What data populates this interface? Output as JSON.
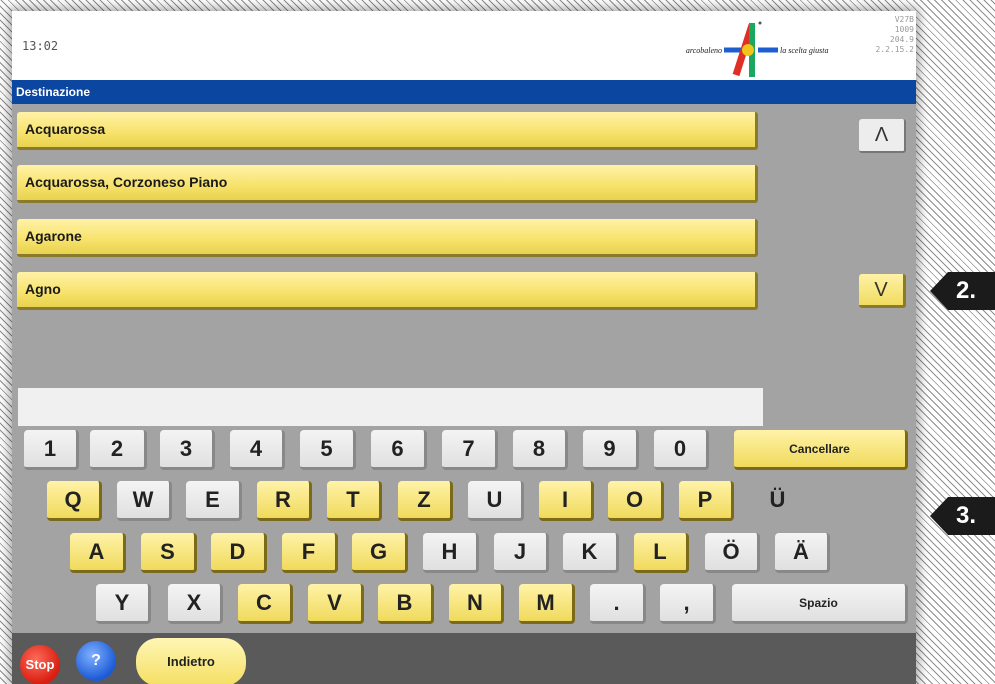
{
  "header": {
    "time": "13:02",
    "logo_left_text": "arcobaleno",
    "logo_right_text": "la scelta giusta",
    "version_lines": [
      "V27B",
      "1009",
      "204.9",
      "2.2.15.2"
    ]
  },
  "section": {
    "title": "Destinazione"
  },
  "destinations": [
    "Acquarossa",
    "Acquarossa, Corzoneso Piano",
    "Agarone",
    "Agno"
  ],
  "scroll": {
    "up_label": "Λ",
    "down_label": "V"
  },
  "input": {
    "value": ""
  },
  "keyboard": {
    "digits": [
      "1",
      "2",
      "3",
      "4",
      "5",
      "6",
      "7",
      "8",
      "9",
      "0"
    ],
    "delete_label": "Cancellare",
    "row1": [
      "Q",
      "W",
      "E",
      "R",
      "T",
      "Z",
      "U",
      "I",
      "O",
      "P",
      "Ü"
    ],
    "row2": [
      "A",
      "S",
      "D",
      "F",
      "G",
      "H",
      "J",
      "K",
      "L",
      "Ö",
      "Ä"
    ],
    "row3": [
      "Y",
      "X",
      "C",
      "V",
      "B",
      "N",
      "M",
      ".",
      ","
    ],
    "space_label": "Spazio"
  },
  "footer": {
    "stop_label": "Stop",
    "help_label": "?",
    "back_label": "Indietro"
  },
  "callouts": [
    "2.",
    "3."
  ],
  "colors": {
    "header_bar": "#0b46a0",
    "key_enabled": "#f5e27a",
    "key_disabled": "#e8e8e8",
    "panel": "#a3a3a3",
    "stop": "#d81e10",
    "help": "#1d5bd6"
  }
}
